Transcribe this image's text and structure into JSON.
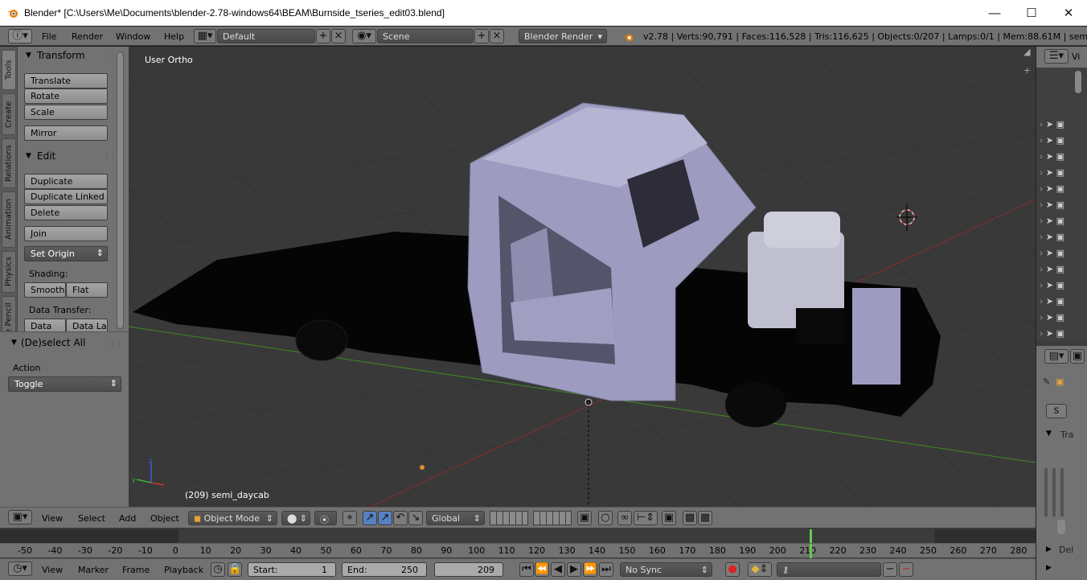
{
  "window": {
    "title": "Blender* [C:\\Users\\Me\\Documents\\blender-2.78-windows64\\BEAM\\Burnside_tseries_edit03.blend]",
    "controls": [
      "minimize-icon",
      "maximize-icon",
      "close-icon"
    ]
  },
  "info_header": {
    "menus": [
      "File",
      "Render",
      "Window",
      "Help"
    ],
    "layout": "Default",
    "scene": "Scene",
    "engine": "Blender Render",
    "stats": "v2.78 | Verts:90,791 | Faces:116,528 | Tris:116,625 | Objects:0/207 | Lamps:0/1 | Mem:88.61M | semi_dayca"
  },
  "side_tabs": [
    "Tools",
    "Create",
    "Relations",
    "Animation",
    "Physics",
    "Grease Pencil"
  ],
  "tool_panel": {
    "transform": {
      "title": "Transform",
      "buttons": [
        "Translate",
        "Rotate",
        "Scale",
        "Mirror"
      ]
    },
    "edit": {
      "title": "Edit",
      "buttons": [
        "Duplicate",
        "Duplicate Linked",
        "Delete",
        "Join"
      ],
      "set_origin": "Set Origin",
      "shading_label": "Shading:",
      "smooth": "Smooth",
      "flat": "Flat",
      "data_transfer_label": "Data Transfer:",
      "data": "Data",
      "data_layers": "Data La"
    },
    "operator": {
      "title": "(De)select All",
      "action_label": "Action",
      "action_value": "Toggle"
    }
  },
  "viewport": {
    "view_name": "User Ortho",
    "object_info": "(209) semi_daycab",
    "colors": {
      "background": "#393939",
      "grid": "#333333",
      "x_axis": "#8a2b2b",
      "y_axis": "#3f8a22",
      "mesh": "#9d9cc0"
    }
  },
  "viewport_header": {
    "menus": [
      "View",
      "Select",
      "Add",
      "Object"
    ],
    "mode": "Object Mode",
    "orientation": "Global"
  },
  "timeline": {
    "ruler_ticks": [
      "-50",
      "-40",
      "-30",
      "-20",
      "-10",
      "0",
      "10",
      "20",
      "30",
      "40",
      "50",
      "60",
      "70",
      "80",
      "90",
      "100",
      "110",
      "120",
      "130",
      "140",
      "150",
      "160",
      "170",
      "180",
      "190",
      "200",
      "210",
      "220",
      "230",
      "240",
      "250",
      "260",
      "270",
      "280"
    ],
    "current_frame_marker": "210",
    "menus": [
      "View",
      "Marker",
      "Frame",
      "Playback"
    ],
    "start_label": "Start:",
    "start_value": "1",
    "end_label": "End:",
    "end_value": "250",
    "current_frame": "209",
    "sync": "No Sync"
  },
  "right_panel": {
    "header_glyph": "Vi",
    "truncated_labels": [
      "Tra",
      "Del"
    ]
  }
}
